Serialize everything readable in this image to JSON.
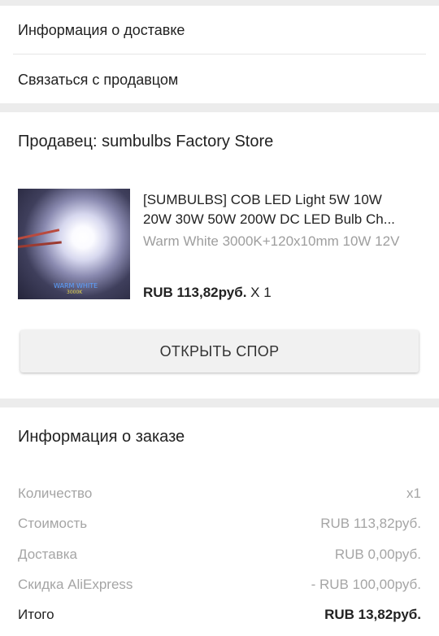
{
  "top_links": {
    "delivery_info": "Информация о доставке",
    "contact_seller": "Связаться с продавцом"
  },
  "seller": {
    "label": "Продавец: sumbulbs Factory Store"
  },
  "product": {
    "title_line1": "[SUMBULBS] COB LED Light 5W 10W",
    "title_line2": "20W 30W 50W 200W DC LED Bulb Ch...",
    "variant": "Warm White 3000K+120x10mm  10W 12V",
    "price": "RUB 113,82руб.",
    "quantity": " X 1",
    "image_caption_1": "WARM WHITE",
    "image_caption_2": "3000K"
  },
  "dispute_button": "ОТКРЫТЬ СПОР",
  "order_info": {
    "title": "Информация о заказе",
    "rows": [
      {
        "label": "Количество",
        "value": "x1"
      },
      {
        "label": "Стоимость",
        "value": "RUB 113,82руб."
      },
      {
        "label": "Доставка",
        "value": "RUB 0,00руб."
      },
      {
        "label": "Скидка AliExpress",
        "value": "- RUB 100,00руб."
      }
    ],
    "total_label": "Итого",
    "total_value": "RUB 13,82руб."
  }
}
